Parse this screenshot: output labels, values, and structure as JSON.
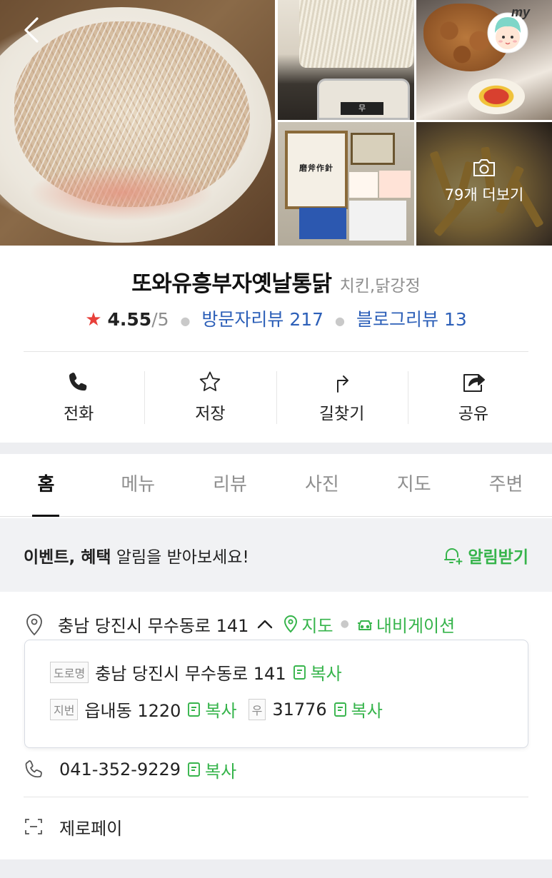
{
  "header": {
    "more_photos_label": "79개 더보기",
    "my_badge": "my"
  },
  "place": {
    "name": "또와유흥부자옛날통닭",
    "category": "치킨,닭강정",
    "rating_star": "★",
    "rating": "4.55",
    "rating_max": "/5",
    "visitor_reviews": "방문자리뷰 217",
    "blog_reviews": "블로그리뷰 13"
  },
  "actions": [
    {
      "label": "전화",
      "icon": "phone-icon"
    },
    {
      "label": "저장",
      "icon": "star-icon"
    },
    {
      "label": "길찾기",
      "icon": "directions-icon"
    },
    {
      "label": "공유",
      "icon": "share-icon"
    }
  ],
  "tabs": [
    {
      "label": "홈",
      "active": true
    },
    {
      "label": "메뉴",
      "active": false
    },
    {
      "label": "리뷰",
      "active": false
    },
    {
      "label": "사진",
      "active": false
    },
    {
      "label": "지도",
      "active": false
    },
    {
      "label": "주변",
      "active": false
    }
  ],
  "event": {
    "bold_text": "이벤트, 혜택",
    "text": " 알림을 받아보세요!",
    "alarm_label": "알림받기"
  },
  "info": {
    "address": "충남 당진시 무수동로 141",
    "map_label": "지도",
    "navi_label": "내비게이션",
    "road_tag": "도로명",
    "road_address": "충남 당진시 무수동로 141",
    "lot_tag": "지번",
    "lot_address": "읍내동 1220",
    "zip_tag": "우",
    "zip": "31776",
    "copy_label": "복사",
    "phone": "041-352-9229",
    "zeropay": "제로페이"
  },
  "colors": {
    "accent_green": "#36b44b",
    "link_blue": "#2c5fb8",
    "star_red": "#e8403a"
  }
}
